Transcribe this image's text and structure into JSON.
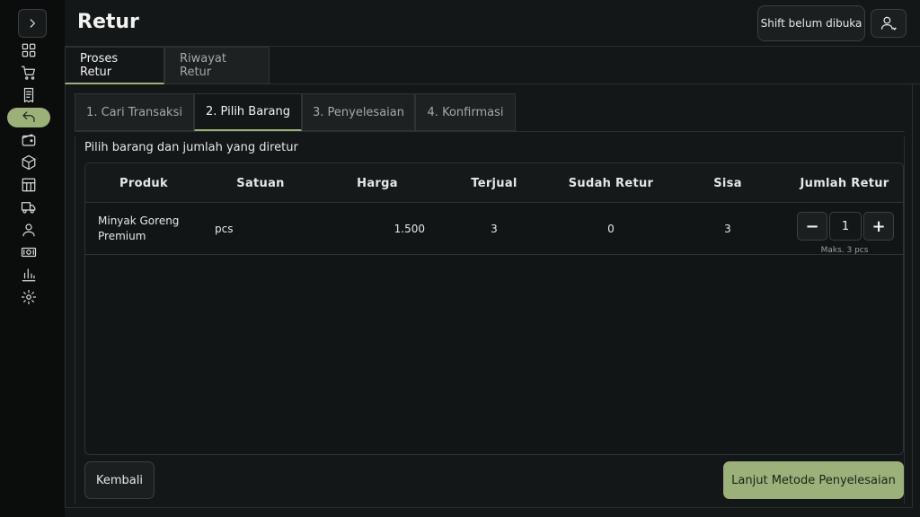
{
  "sidebar": {
    "items": [
      {
        "icon": "grid-icon"
      },
      {
        "icon": "cart-icon"
      },
      {
        "icon": "receipt-icon"
      },
      {
        "icon": "return-icon",
        "active": true
      },
      {
        "icon": "wallet-icon"
      },
      {
        "icon": "box-icon"
      },
      {
        "icon": "table-icon"
      },
      {
        "icon": "truck-icon"
      },
      {
        "icon": "user-icon"
      },
      {
        "icon": "cash-icon"
      },
      {
        "icon": "bar-chart-icon"
      },
      {
        "icon": "gear-icon"
      }
    ]
  },
  "header": {
    "title": "Retur",
    "shift_label": "Shift belum dibuka"
  },
  "main_tabs": [
    {
      "label": "Proses Retur"
    },
    {
      "label": "Riwayat Retur"
    }
  ],
  "steps": [
    {
      "label": "1. Cari Transaksi"
    },
    {
      "label": "2. Pilih Barang"
    },
    {
      "label": "3. Penyelesaian"
    },
    {
      "label": "4. Konfirmasi"
    }
  ],
  "instruction": "Pilih barang dan jumlah yang diretur",
  "table": {
    "headers": {
      "produk": "Produk",
      "satuan": "Satuan",
      "harga": "Harga",
      "terjual": "Terjual",
      "sudah_retur": "Sudah Retur",
      "sisa": "Sisa",
      "jumlah_retur": "Jumlah Retur"
    },
    "rows": [
      {
        "produk": "Minyak Goreng Premium",
        "satuan": "pcs",
        "harga": "1.500",
        "terjual": "3",
        "sudah_retur": "0",
        "sisa": "3",
        "jumlah_retur": "1",
        "max_hint": "Maks. 3 pcs"
      }
    ]
  },
  "stepper": {
    "minus": "−",
    "plus": "+"
  },
  "actions": {
    "back": "Kembali",
    "next": "Lanjut Metode Penyelesaian"
  },
  "colors": {
    "accent": "#9cb07a",
    "background": "#141717"
  }
}
